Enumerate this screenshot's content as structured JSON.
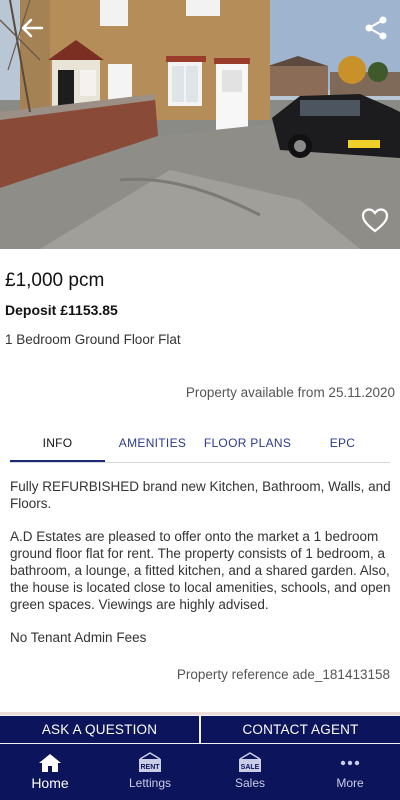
{
  "listing": {
    "price": "£1,000 pcm",
    "deposit": "Deposit £1153.85",
    "property_type": "1 Bedroom Ground Floor Flat",
    "available": "Property available from 25.11.2020",
    "reference": "Property reference ade_181413158"
  },
  "tabs": [
    {
      "label": "INFO",
      "active": true
    },
    {
      "label": "AMENITIES",
      "active": false
    },
    {
      "label": "FLOOR PLANS",
      "active": false
    },
    {
      "label": "EPC",
      "active": false
    }
  ],
  "info": {
    "paragraph_1": "Fully REFURBISHED brand new Kitchen, Bathroom, Walls, and Floors.",
    "paragraph_2": "A.D Estates are pleased to offer onto the market a 1 bedroom ground floor flat for rent. The property consists of 1 bedroom, a bathroom, a lounge, a fitted kitchen, and a shared garden. Also, the house is located close to local amenities, schools, and open green spaces. Viewings are highly advised.",
    "paragraph_3": "No Tenant Admin Fees"
  },
  "actions": {
    "ask_label": "ASK A QUESTION",
    "contact_label": "CONTACT AGENT"
  },
  "bottom_nav": {
    "home": "Home",
    "lettings": "Lettings",
    "lettings_badge": "RENT",
    "sales": "Sales",
    "sales_badge": "SALE",
    "more": "More"
  },
  "icons": {
    "back": "arrow-left-icon",
    "share": "share-icon",
    "favourite": "heart-outline-icon"
  },
  "colors": {
    "brand_navy": "#0c145c",
    "tab_text": "#2a3a8a"
  }
}
